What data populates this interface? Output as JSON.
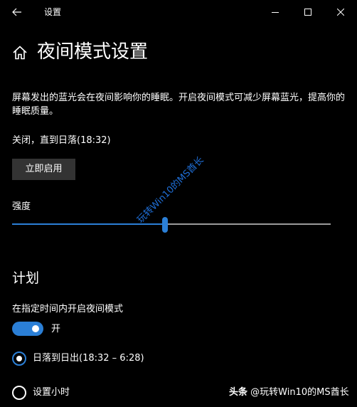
{
  "window": {
    "title": "设置"
  },
  "header": {
    "title": "夜间模式设置"
  },
  "description": "屏幕发出的蓝光会在夜间影响你的睡眠。开启夜间模式可减少屏幕蓝光，提高你的睡眠质量。",
  "status": "关闭，直到日落(18:32)",
  "enable_button": "立即启用",
  "strength": {
    "label": "强度",
    "value_fraction": 0.48
  },
  "watermark": "玩转Win10的MS酋长",
  "schedule": {
    "section_title": "计划",
    "toggle_label": "在指定时间内开启夜间模式",
    "toggle_state": "开",
    "options": [
      {
        "label": "日落到日出(18:32 – 6:28)",
        "selected": true
      },
      {
        "label": "设置小时",
        "selected": false
      }
    ]
  },
  "footer_watermark": {
    "prefix": "头条",
    "text": " @玩转Win10的MS酋长"
  },
  "colors": {
    "background": "#000000",
    "accent": "#2b7fd6",
    "button_bg": "#333333",
    "track": "#9a9a9a"
  }
}
